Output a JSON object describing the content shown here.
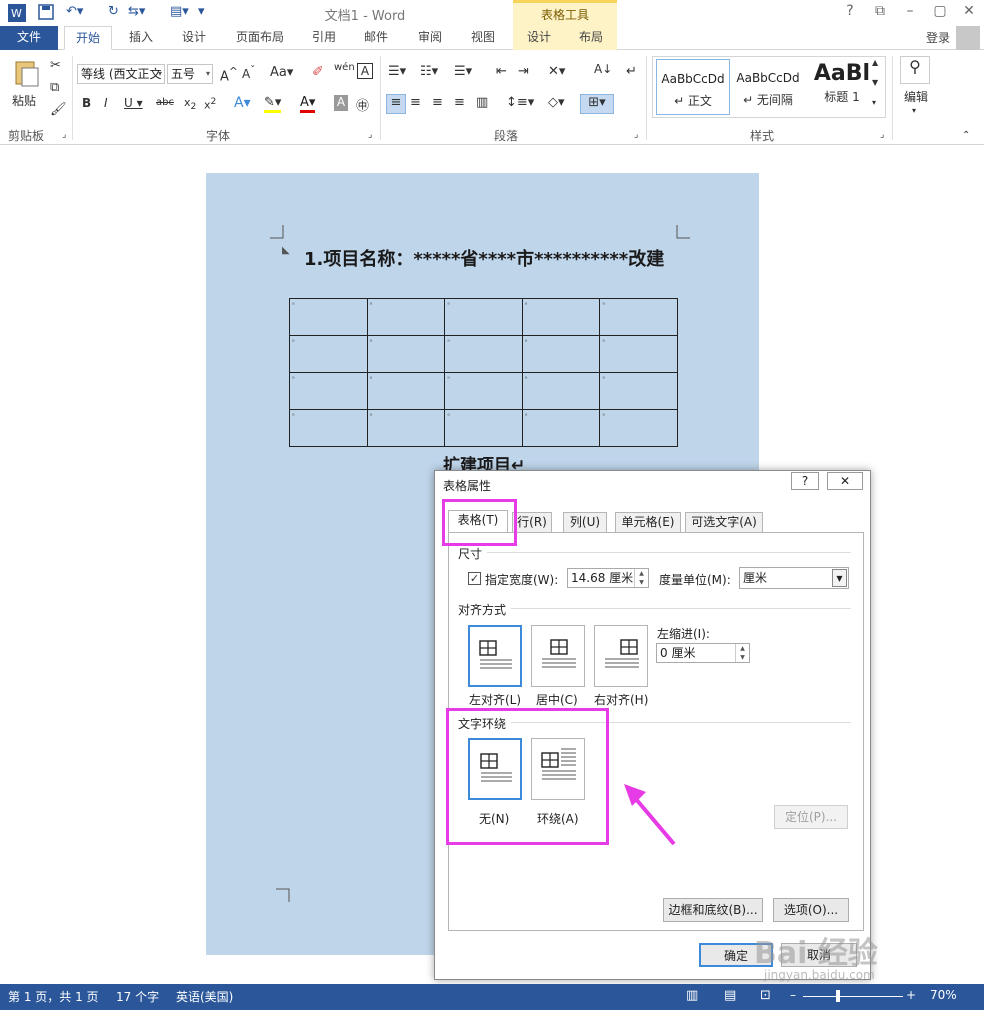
{
  "titlebar": {
    "title": "文档1 - Word",
    "context_group": "表格工具"
  },
  "tabs": {
    "file": "文件",
    "home": "开始",
    "insert": "插入",
    "design": "设计",
    "layout": "页面布局",
    "references": "引用",
    "mailings": "邮件",
    "review": "审阅",
    "view": "视图",
    "table_design": "设计",
    "table_layout": "布局",
    "login": "登录"
  },
  "ribbon": {
    "paste": "粘贴",
    "clipboard": "剪贴板",
    "font_name": "等线 (西文正文",
    "font_size": "五号",
    "font_group": "字体",
    "paragraph_group": "段落",
    "styles_group": "样式",
    "edit": "编辑",
    "styles": [
      {
        "sample": "AaBbCcDd",
        "name": "↵ 正文"
      },
      {
        "sample": "AaBbCcDd",
        "name": "↵ 无间隔"
      },
      {
        "sample": "AaBl",
        "name": "标题 1"
      }
    ]
  },
  "document": {
    "title": "1.项目名称：*****省****市**********改建",
    "line2": "扩建项目↵",
    "cell_mark": "ᵃ"
  },
  "dialog": {
    "title": "表格属性",
    "help": "?",
    "close": "✕",
    "tabs": [
      "表格(T)",
      "行(R)",
      "列(U)",
      "单元格(E)",
      "可选文字(A)"
    ],
    "size_section": "尺寸",
    "preferred_width_label": "指定宽度(W):",
    "preferred_width_value": "14.68 厘米",
    "measure_label": "度量单位(M):",
    "measure_value": "厘米",
    "alignment_section": "对齐方式",
    "indent_label": "左缩进(I):",
    "indent_value": "0 厘米",
    "align_left": "左对齐(L)",
    "align_center": "居中(C)",
    "align_right": "右对齐(H)",
    "wrap_section": "文字环绕",
    "wrap_none": "无(N)",
    "wrap_around": "环绕(A)",
    "positioning": "定位(P)...",
    "borders": "边框和底纹(B)...",
    "options": "选项(O)...",
    "ok": "确定",
    "cancel": "取消"
  },
  "statusbar": {
    "page": "第 1 页，共 1 页",
    "words": "17 个字",
    "language": "英语(美国)",
    "zoom": "70%"
  },
  "watermark": {
    "brand": "Bai 经验",
    "url": "jingyan.baidu.com"
  },
  "colors": {
    "accent": "#2b579a",
    "highlight": "#e63be6",
    "page": "#bfd5ea"
  }
}
